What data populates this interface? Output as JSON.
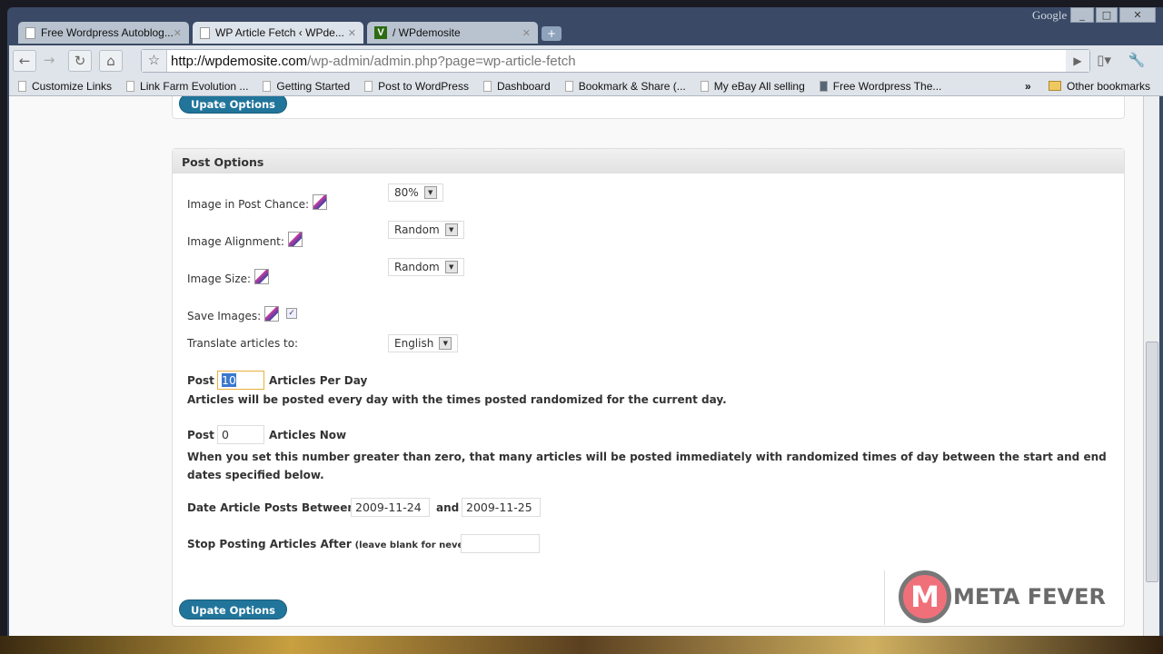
{
  "browser": {
    "tabs": [
      {
        "title": "Free Wordpress Autoblog...",
        "icon": "page-icon"
      },
      {
        "title": "WP Article Fetch ‹ WPde...",
        "icon": "page-icon"
      },
      {
        "title": "/  WPdemosite",
        "icon": "v-icon"
      }
    ],
    "google_label": "Google",
    "url_domain": "http://wpdemosite.com",
    "url_path": "/wp-admin/admin.php?page=wp-article-fetch",
    "bookmarks": [
      "Customize Links",
      "Link Farm Evolution ...",
      "Getting Started",
      "Post to WordPress",
      "Dashboard",
      "Bookmark & Share (...",
      "My eBay All selling",
      "Free Wordpress The..."
    ],
    "other_bookmarks": "Other bookmarks",
    "overflow": "»"
  },
  "page": {
    "update_button": "Upate Options",
    "section_title": "Post Options",
    "image_chance_label": "Image in Post Chance:",
    "image_chance_value": "80%",
    "image_alignment_label": "Image Alignment:",
    "image_alignment_value": "Random",
    "image_size_label": "Image Size:",
    "image_size_value": "Random",
    "save_images_label": "Save Images:",
    "save_images_checked": true,
    "translate_label": "Translate articles to:",
    "translate_value": "English",
    "post_label": "Post",
    "per_day_value": "10",
    "per_day_label": "Articles Per Day",
    "per_day_help": "Articles will be posted every day with the times posted randomized for the current day.",
    "now_value": "0",
    "now_label": "Articles Now",
    "now_help": "When you set this number greater than zero, that many articles will be posted immediately with randomized times of day between the start and end dates specified below.",
    "date_label": "Date Article Posts Between",
    "date_start": "2009-11-24",
    "and_label": "and",
    "date_end": "2009-11-25",
    "stop_label": "Stop Posting Articles After",
    "stop_hint": "(leave blank for never):",
    "stop_value": ""
  },
  "watermark": {
    "text": "META FEVER",
    "letter": "M"
  }
}
